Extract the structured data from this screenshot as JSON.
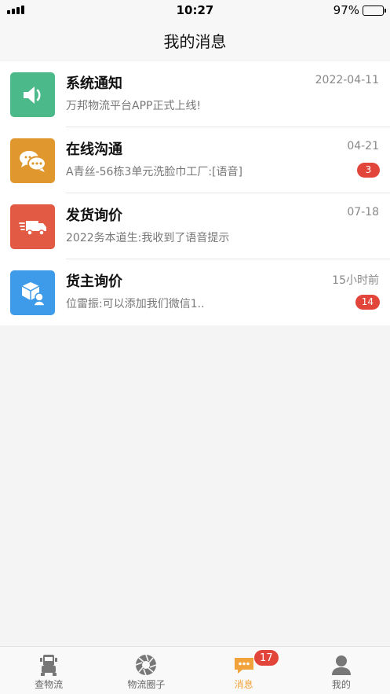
{
  "status_bar": {
    "time": "10:27",
    "battery": "97%",
    "battery_level": 0.97
  },
  "header": {
    "title": "我的消息"
  },
  "messages": [
    {
      "title": "系统通知",
      "time": "2022-04-11",
      "preview": "万邦物流平台APP正式上线!",
      "badge": "",
      "icon": "speaker-icon",
      "color": "#4cb98a"
    },
    {
      "title": "在线沟通",
      "time": "04-21",
      "preview": "A青丝-56栋3单元洗脸巾工厂:[语音]",
      "badge": "3",
      "icon": "chat-bubbles-icon",
      "color": "#e0982e"
    },
    {
      "title": "发货询价",
      "time": "07-18",
      "preview": "2022务本道生:我收到了语音提示",
      "badge": "",
      "icon": "delivery-truck-icon",
      "color": "#e25a43"
    },
    {
      "title": "货主询价",
      "time": "15小时前",
      "preview": "位雷振:可以添加我们微信1..",
      "badge": "14",
      "icon": "package-user-icon",
      "color": "#3d9be9"
    }
  ],
  "tabs": [
    {
      "label": "查物流",
      "icon": "truck-icon",
      "active": false,
      "badge": ""
    },
    {
      "label": "物流圈子",
      "icon": "aperture-icon",
      "active": false,
      "badge": ""
    },
    {
      "label": "消息",
      "icon": "message-icon",
      "active": true,
      "badge": "17"
    },
    {
      "label": "我的",
      "icon": "user-icon",
      "active": false,
      "badge": ""
    }
  ],
  "colors": {
    "accent": "#f2a23a",
    "badge": "#e2453a"
  }
}
